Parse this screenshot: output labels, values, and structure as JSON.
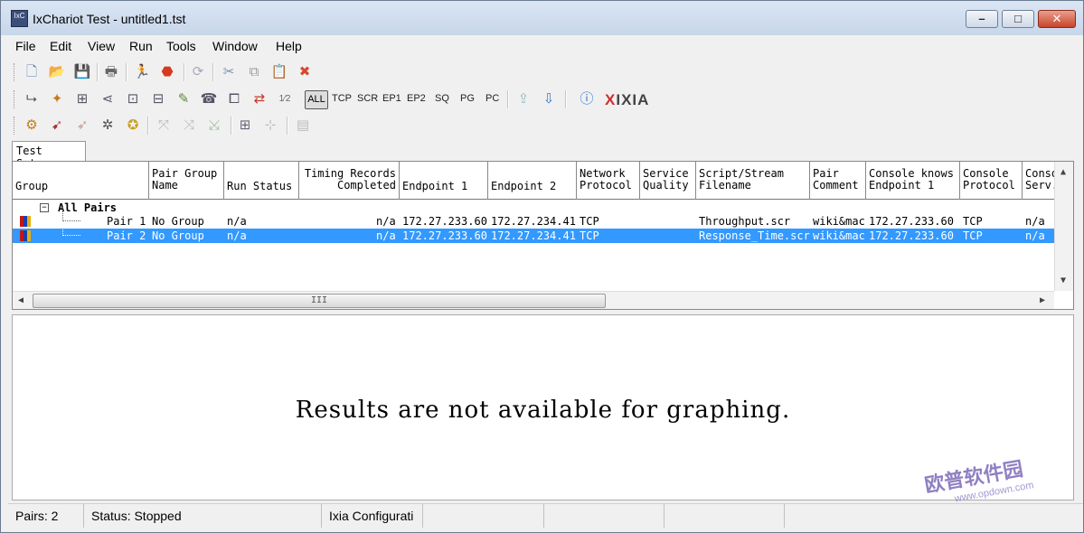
{
  "window": {
    "title": "IxChariot Test - untitled1.tst",
    "app_icon_text": "IxC"
  },
  "window_controls": {
    "minimize": "–",
    "maximize": "□",
    "close": "✕"
  },
  "menu": [
    "File",
    "Edit",
    "View",
    "Run",
    "Tools",
    "Window",
    "Help"
  ],
  "toolbar2_text": {
    "all": "ALL",
    "tcp": "TCP",
    "scr": "SCR",
    "ep1": "EP1",
    "ep2": "EP2",
    "sq": "SQ",
    "pg": "PG",
    "pc": "PC"
  },
  "brand": {
    "logo_x": "X",
    "logo_rest": "IXIA"
  },
  "tab": {
    "label": "Test Setup"
  },
  "grid": {
    "headers": {
      "group": "Group",
      "pair_group_name": "Pair Group\nName",
      "run_status": "Run Status",
      "timing_records": "Timing Records\nCompleted",
      "endpoint1": "Endpoint 1",
      "endpoint2": "Endpoint 2",
      "network_protocol": "Network\nProtocol",
      "service_quality": "Service\nQuality",
      "script_filename": "Script/Stream\nFilename",
      "pair_comment": "Pair\nComment",
      "console_knows_ep1": "Console knows\nEndpoint 1",
      "console_protocol": "Console\nProtocol",
      "console_server": "Conso\nServ."
    },
    "group_label": "All Pairs",
    "group_toggle": "−",
    "rows": [
      {
        "pair": "Pair 1",
        "group_name": "No Group",
        "run_status": "n/a",
        "timing": "n/a",
        "ep1": "172.27.233.60",
        "ep2": "172.27.234.41",
        "protocol": "TCP",
        "quality": "",
        "script": "Throughput.scr",
        "comment": "wiki&mac",
        "console_ep1": "172.27.233.60",
        "console_protocol": "TCP",
        "console_server": "n/a"
      },
      {
        "pair": "Pair 2",
        "group_name": "No Group",
        "run_status": "n/a",
        "timing": "n/a",
        "ep1": "172.27.233.60",
        "ep2": "172.27.234.41",
        "protocol": "TCP",
        "quality": "",
        "script": "Response_Time.scr",
        "comment": "wiki&mac",
        "console_ep1": "172.27.233.60",
        "console_protocol": "TCP",
        "console_server": "n/a"
      }
    ],
    "scroll_grip": "III"
  },
  "graph": {
    "message": "Results are not available for graphing."
  },
  "status": {
    "pairs": "Pairs: 2",
    "state": "Status: Stopped",
    "config": "Ixia Configurati"
  },
  "watermark": {
    "main": "欧普软件园",
    "sub": "www.opdown.com"
  },
  "colors": {
    "selection": "#3399ff",
    "close_button": "#c8432a"
  }
}
